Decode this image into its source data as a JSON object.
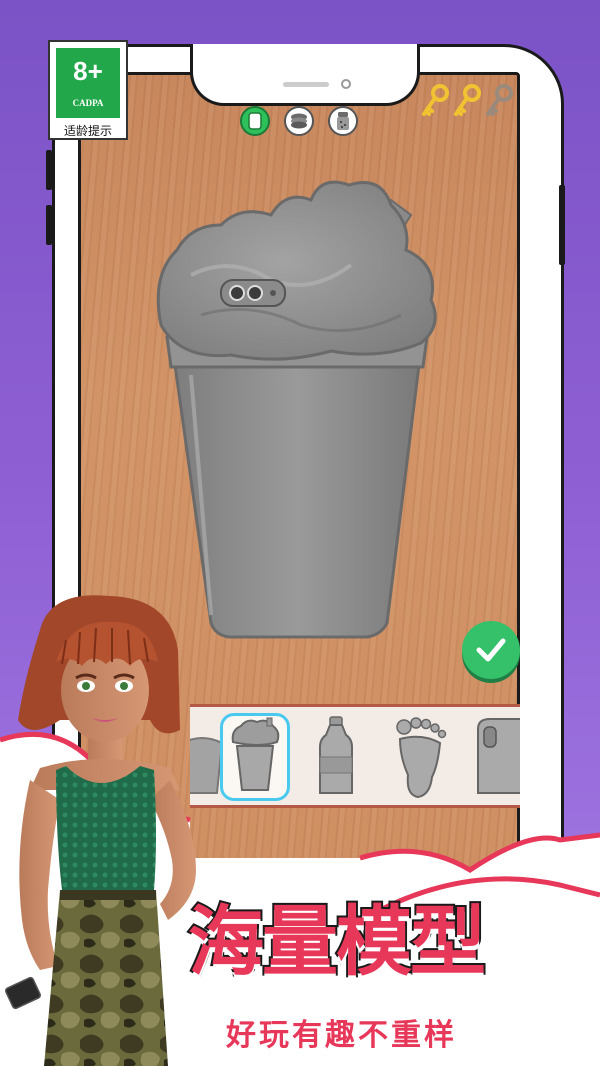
{
  "rating": {
    "age": "8+",
    "org": "CADPA",
    "tip": "适龄提示"
  },
  "toolbar": {
    "tools": [
      {
        "icon": "phone-case-icon",
        "active": true
      },
      {
        "icon": "layers-icon",
        "active": false
      },
      {
        "icon": "shaker-icon",
        "active": false
      }
    ]
  },
  "keys": {
    "collected": 2,
    "total": 3,
    "colors": {
      "collected": "#f1c232",
      "empty": "#9a8a7c"
    }
  },
  "workspace": {
    "current_model": "cup-with-whipped-cream",
    "model_color": "#8f8f8f"
  },
  "tray": {
    "items": [
      "partial-shape",
      "cup",
      "bottle",
      "foot",
      "phone-case"
    ],
    "selected_index": 1
  },
  "banner": {
    "title": "海量模型",
    "subtitle": "好玩有趣不重样"
  },
  "colors": {
    "accent": "#e8385a",
    "confirm": "#35c06a",
    "background": "#8e5fd3",
    "selection": "#4ac9ef"
  }
}
